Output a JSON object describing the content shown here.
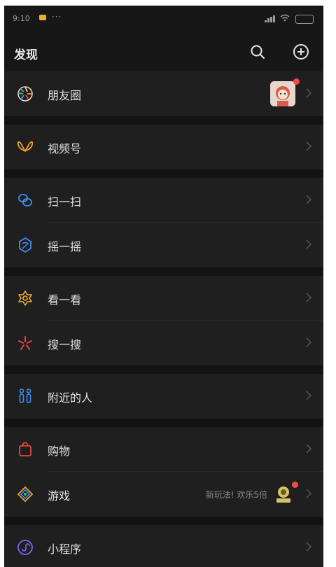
{
  "status": {
    "time": "9:10",
    "dots": "···"
  },
  "header": {
    "title": "发现"
  },
  "rows": {
    "moments": {
      "label": "朋友圈"
    },
    "channels": {
      "label": "视频号"
    },
    "scan": {
      "label": "扫一扫"
    },
    "shake": {
      "label": "摇一摇"
    },
    "top_stories": {
      "label": "看一看"
    },
    "search": {
      "label": "搜一搜"
    },
    "nearby": {
      "label": "附近的人"
    },
    "shopping": {
      "label": "购物"
    },
    "games": {
      "label": "游戏",
      "note": "新玩法! 欢乐5倍"
    },
    "mini_programs": {
      "label": "小程序"
    }
  },
  "colors": {
    "background": "#171717",
    "row": "#1f1f1f",
    "text": "#e1e1e1",
    "badge": "#f24a4a"
  }
}
